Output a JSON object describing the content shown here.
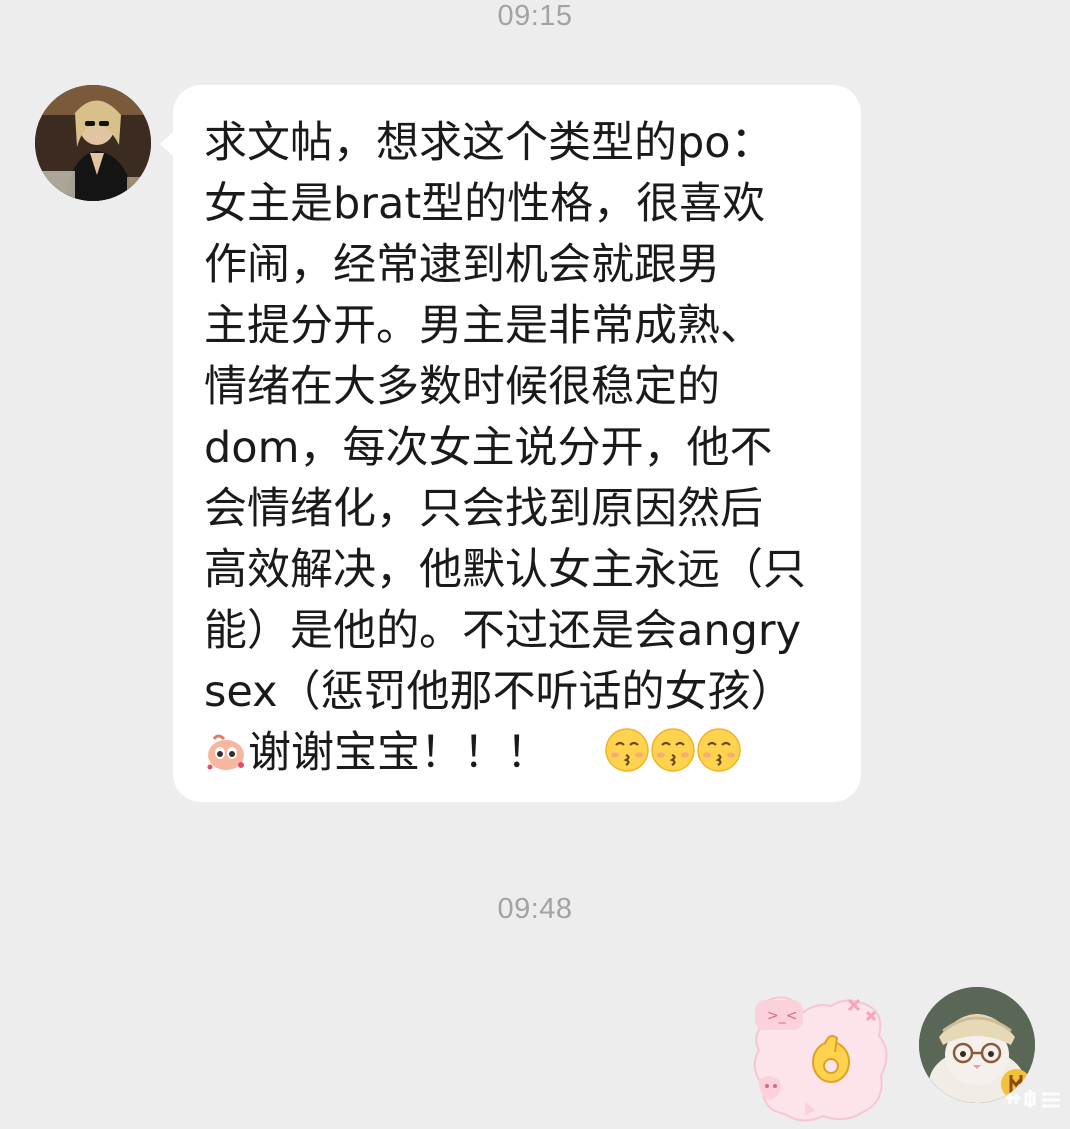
{
  "chat": {
    "timestamps": [
      "09:15",
      "09:48"
    ],
    "incoming_message": {
      "lines": [
        "求文帖，想求这个类型的po：",
        "女主是brat型的性格，很喜欢",
        "作闹，经常逮到机会就跟男",
        "主提分开。男主是非常成熟、",
        "情绪在大多数时候很稳定的",
        "dom，每次女主说分开，他不",
        "会情绪化，只会找到原因然后",
        "高效解决，他默认女主永远（只",
        "能）是他的。不过还是会angry",
        "sex（惩罚他那不听话的女孩）"
      ],
      "last_line_text": "谢谢宝宝！！！",
      "emojis": [
        "sticker-emoji-icon",
        "kissing-face-emoji",
        "kissing-face-emoji",
        "kissing-face-emoji"
      ]
    },
    "outgoing_sticker": "ok-hand-cartoon-sticker"
  },
  "colors": {
    "background": "#ededed",
    "bubble": "#ffffff",
    "timestamp": "#a3a3a3",
    "text": "#1a1a1a"
  }
}
